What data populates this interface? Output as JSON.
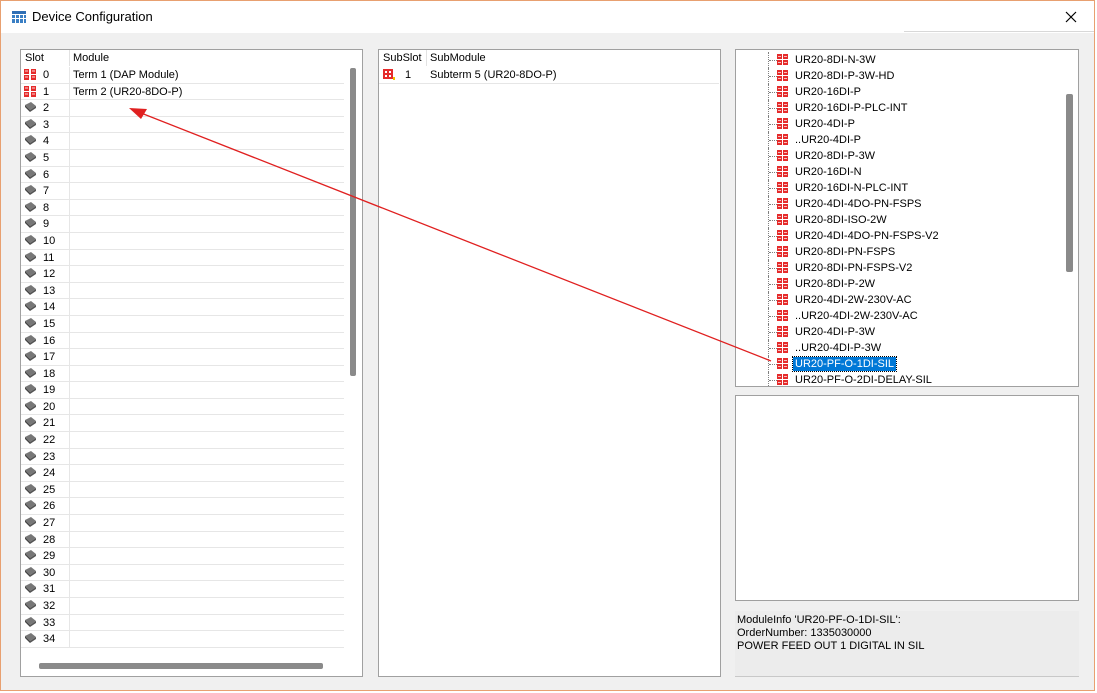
{
  "window": {
    "title": "Device Configuration"
  },
  "slot_grid": {
    "col_slot": "Slot",
    "col_module": "Module",
    "rows": [
      {
        "slot": "0",
        "module": "Term 1 (DAP Module)",
        "occupied": true
      },
      {
        "slot": "1",
        "module": "Term 2 (UR20-8DO-P)",
        "occupied": true
      },
      {
        "slot": "2",
        "module": "",
        "occupied": false
      },
      {
        "slot": "3",
        "module": "",
        "occupied": false
      },
      {
        "slot": "4",
        "module": "",
        "occupied": false
      },
      {
        "slot": "5",
        "module": "",
        "occupied": false
      },
      {
        "slot": "6",
        "module": "",
        "occupied": false
      },
      {
        "slot": "7",
        "module": "",
        "occupied": false
      },
      {
        "slot": "8",
        "module": "",
        "occupied": false
      },
      {
        "slot": "9",
        "module": "",
        "occupied": false
      },
      {
        "slot": "10",
        "module": "",
        "occupied": false
      },
      {
        "slot": "11",
        "module": "",
        "occupied": false
      },
      {
        "slot": "12",
        "module": "",
        "occupied": false
      },
      {
        "slot": "13",
        "module": "",
        "occupied": false
      },
      {
        "slot": "14",
        "module": "",
        "occupied": false
      },
      {
        "slot": "15",
        "module": "",
        "occupied": false
      },
      {
        "slot": "16",
        "module": "",
        "occupied": false
      },
      {
        "slot": "17",
        "module": "",
        "occupied": false
      },
      {
        "slot": "18",
        "module": "",
        "occupied": false
      },
      {
        "slot": "19",
        "module": "",
        "occupied": false
      },
      {
        "slot": "20",
        "module": "",
        "occupied": false
      },
      {
        "slot": "21",
        "module": "",
        "occupied": false
      },
      {
        "slot": "22",
        "module": "",
        "occupied": false
      },
      {
        "slot": "23",
        "module": "",
        "occupied": false
      },
      {
        "slot": "24",
        "module": "",
        "occupied": false
      },
      {
        "slot": "25",
        "module": "",
        "occupied": false
      },
      {
        "slot": "26",
        "module": "",
        "occupied": false
      },
      {
        "slot": "27",
        "module": "",
        "occupied": false
      },
      {
        "slot": "28",
        "module": "",
        "occupied": false
      },
      {
        "slot": "29",
        "module": "",
        "occupied": false
      },
      {
        "slot": "30",
        "module": "",
        "occupied": false
      },
      {
        "slot": "31",
        "module": "",
        "occupied": false
      },
      {
        "slot": "32",
        "module": "",
        "occupied": false
      },
      {
        "slot": "33",
        "module": "",
        "occupied": false
      },
      {
        "slot": "34",
        "module": "",
        "occupied": false
      }
    ]
  },
  "subslot_grid": {
    "col_subslot": "SubSlot",
    "col_submodule": "SubModule",
    "rows": [
      {
        "subslot": "1",
        "submodule": "Subterm 5 (UR20-8DO-P)"
      }
    ]
  },
  "module_tree": {
    "items": [
      {
        "label": "UR20-8DI-N-3W",
        "selected": false
      },
      {
        "label": "UR20-8DI-P-3W-HD",
        "selected": false
      },
      {
        "label": "UR20-16DI-P",
        "selected": false
      },
      {
        "label": "UR20-16DI-P-PLC-INT",
        "selected": false
      },
      {
        "label": "UR20-4DI-P",
        "selected": false
      },
      {
        "label": "..UR20-4DI-P",
        "selected": false
      },
      {
        "label": "UR20-8DI-P-3W",
        "selected": false
      },
      {
        "label": "UR20-16DI-N",
        "selected": false
      },
      {
        "label": "UR20-16DI-N-PLC-INT",
        "selected": false
      },
      {
        "label": "UR20-4DI-4DO-PN-FSPS",
        "selected": false
      },
      {
        "label": "UR20-8DI-ISO-2W",
        "selected": false
      },
      {
        "label": "UR20-4DI-4DO-PN-FSPS-V2",
        "selected": false
      },
      {
        "label": "UR20-8DI-PN-FSPS",
        "selected": false
      },
      {
        "label": "UR20-8DI-PN-FSPS-V2",
        "selected": false
      },
      {
        "label": "UR20-8DI-P-2W",
        "selected": false
      },
      {
        "label": "UR20-4DI-2W-230V-AC",
        "selected": false
      },
      {
        "label": "..UR20-4DI-2W-230V-AC",
        "selected": false
      },
      {
        "label": "UR20-4DI-P-3W",
        "selected": false
      },
      {
        "label": "..UR20-4DI-P-3W",
        "selected": false
      },
      {
        "label": "UR20-PF-O-1DI-SIL",
        "selected": true
      },
      {
        "label": "UR20-PF-O-2DI-DELAY-SIL",
        "selected": false
      }
    ]
  },
  "module_info": {
    "line1": "ModuleInfo 'UR20-PF-O-1DI-SIL':",
    "line2": "OrderNumber: 1335030000",
    "line3": "POWER FEED OUT 1 DIGITAL IN SIL"
  },
  "colors": {
    "selection": "#0078d7",
    "arrow": "#e02020",
    "module_icon": "#e52b2b"
  }
}
